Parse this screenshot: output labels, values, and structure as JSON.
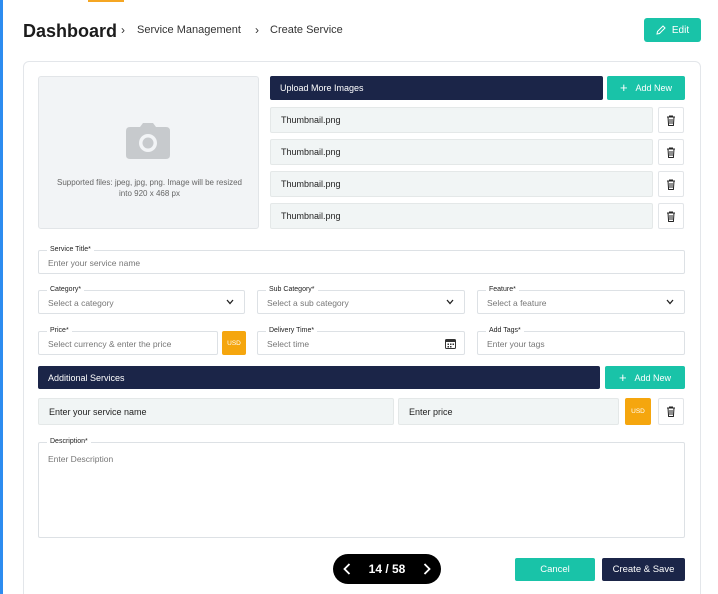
{
  "header": {
    "title": "Dashboard",
    "breadcrumb": [
      "Service Management",
      "Create Service"
    ],
    "edit_label": "Edit"
  },
  "images": {
    "hint": "Supported files: jpeg, jpg, png. Image will be resized into 920 x 468 px",
    "upload_more_label": "Upload More Images",
    "add_new_label": "Add New",
    "thumbnails": [
      "Thumbnail.png",
      "Thumbnail.png",
      "Thumbnail.png",
      "Thumbnail.png"
    ]
  },
  "form": {
    "service_title": {
      "label": "Service Title*",
      "placeholder": "Enter your service name"
    },
    "category": {
      "label": "Category*",
      "placeholder": "Select a category"
    },
    "sub_category": {
      "label": "Sub Category*",
      "placeholder": "Select a sub category"
    },
    "feature": {
      "label": "Feature*",
      "placeholder": "Select a feature"
    },
    "price": {
      "label": "Price*",
      "placeholder": "Select currency & enter the price",
      "currency": "USD"
    },
    "delivery_time": {
      "label": "Delivery Time*",
      "placeholder": "Select time"
    },
    "add_tags": {
      "label": "Add Tags*",
      "placeholder": "Enter your tags"
    }
  },
  "additional_services": {
    "title": "Additional Services",
    "add_new_label": "Add New",
    "name_placeholder": "Enter your service name",
    "price_placeholder": "Enter price",
    "currency": "USD"
  },
  "description": {
    "label": "Description*",
    "placeholder": "Enter Description"
  },
  "pager": {
    "current": "14 / 58"
  },
  "actions": {
    "cancel_label": "Cancel",
    "save_label": "Create & Save"
  },
  "colors": {
    "teal": "#19c3a8",
    "navy": "#1b2548",
    "orange": "#f5a60e"
  }
}
